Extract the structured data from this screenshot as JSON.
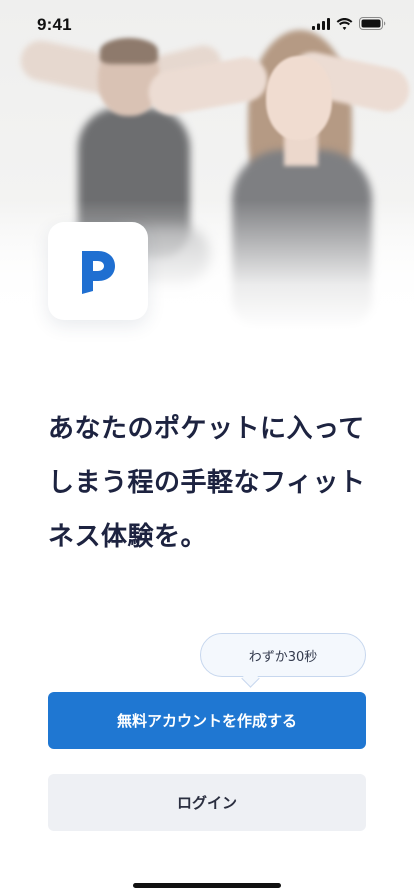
{
  "status_bar": {
    "time": "9:41",
    "icons": [
      "cellular-signal-icon",
      "wifi-icon",
      "battery-icon"
    ]
  },
  "hero": {
    "image": "two people exercising"
  },
  "app_icon": {
    "icon": "pocket-p-logo",
    "brand_color": "#1f6fd1"
  },
  "headline": {
    "lines": [
      "あなたのポケットに入って",
      "しまう程の手軽なフィット",
      "ネス体験を。"
    ]
  },
  "bubble": {
    "text": "わずか30秒"
  },
  "buttons": {
    "primary_label": "無料アカウントを作成する",
    "secondary_label": "ログイン"
  },
  "colors": {
    "primary": "#1f77d2",
    "secondary_bg": "#eef0f4",
    "headline": "#1d2340"
  }
}
